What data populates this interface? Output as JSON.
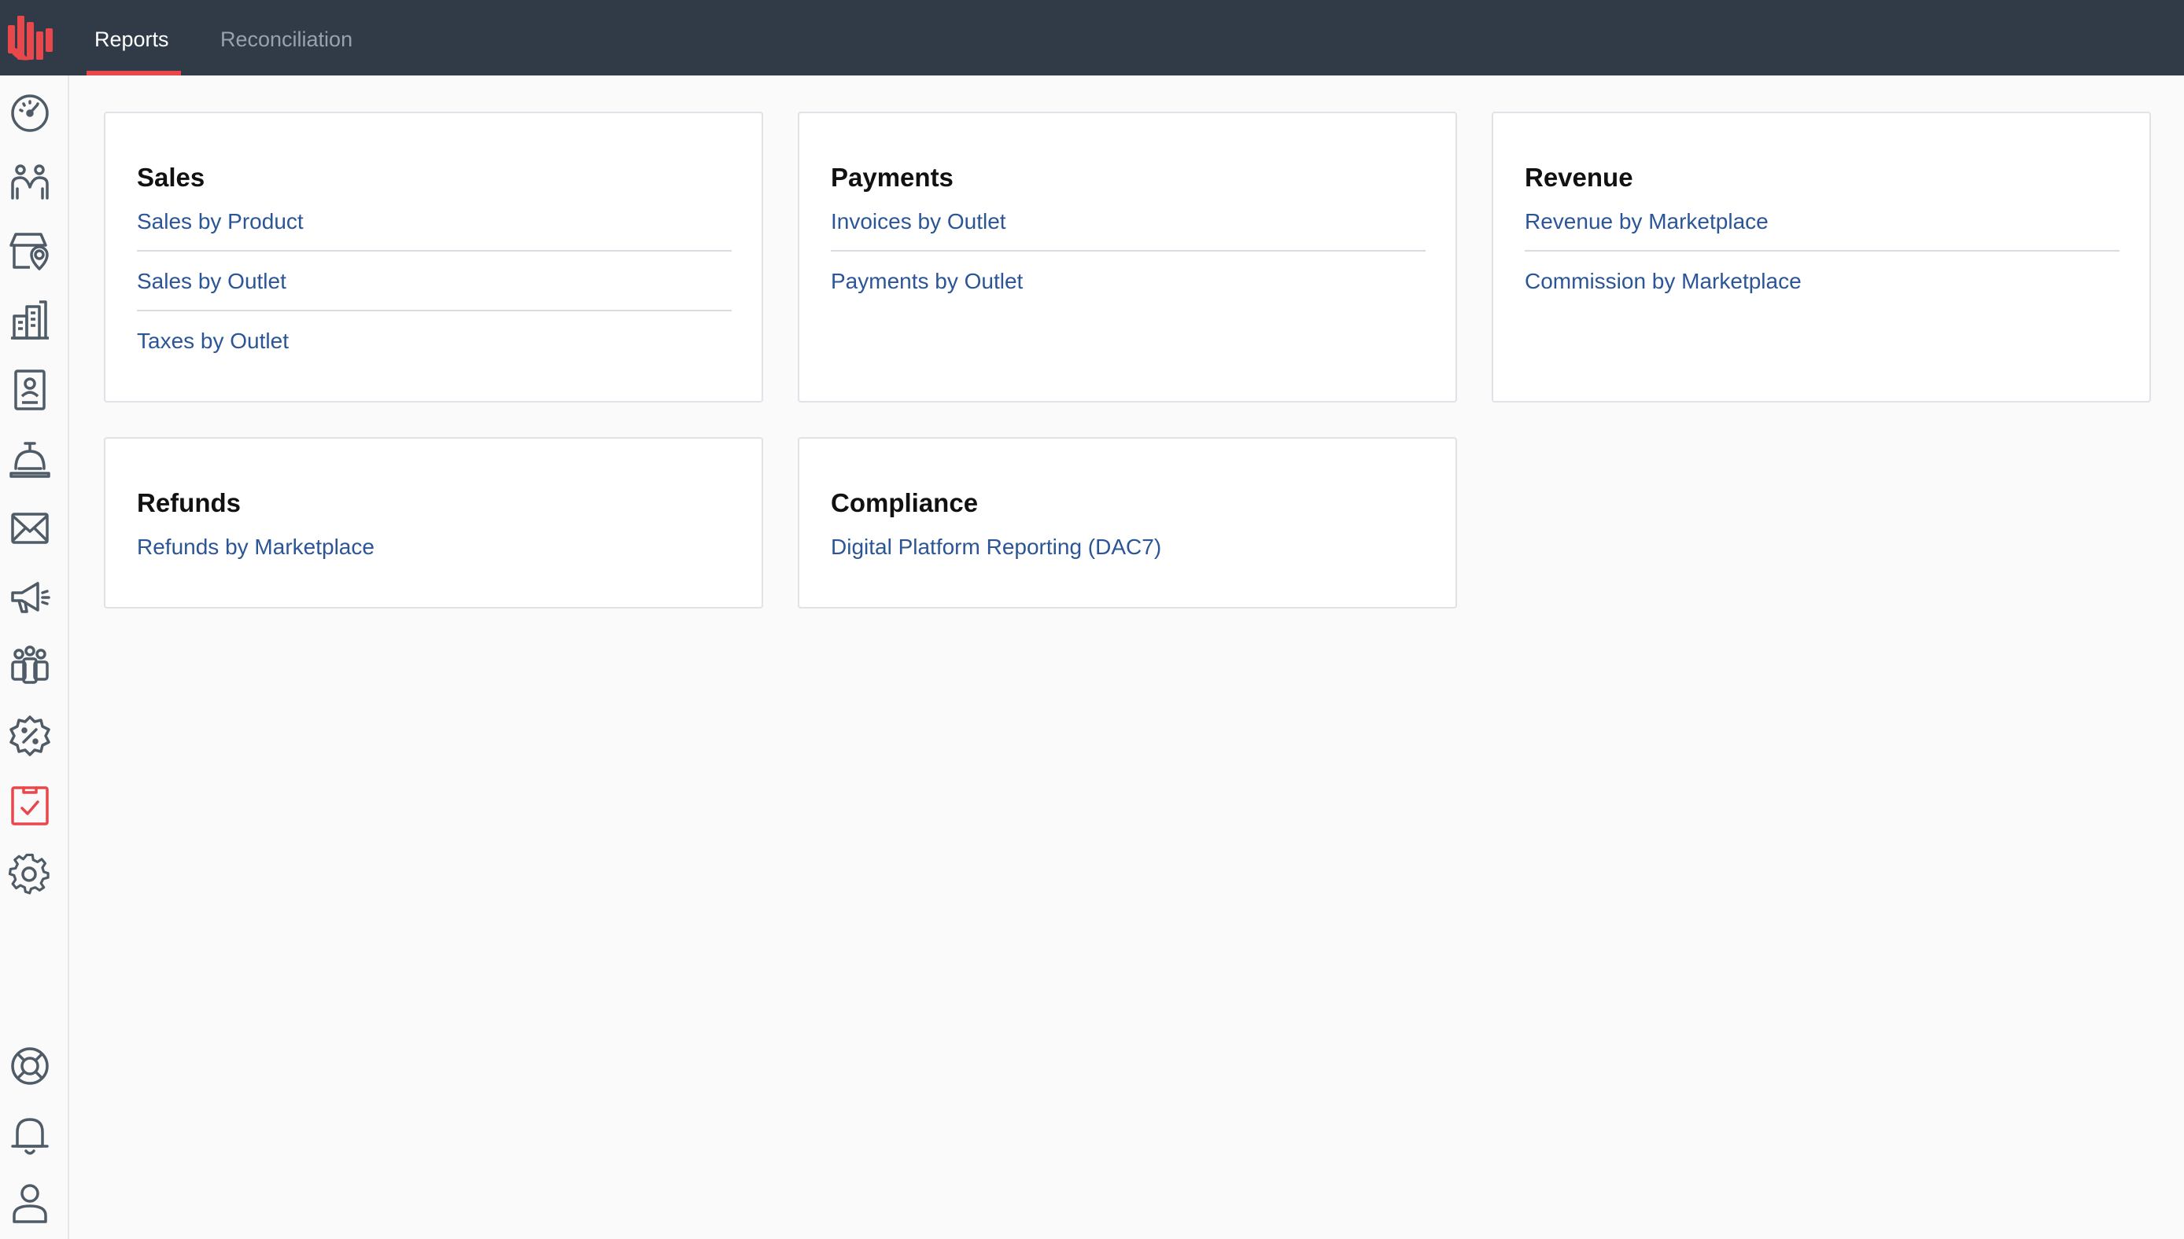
{
  "app": {
    "brand_color": "#e8474c",
    "header_bg": "#313b47",
    "link_color": "#2b5596"
  },
  "header": {
    "tabs": [
      {
        "label": "Reports",
        "active": true
      },
      {
        "label": "Reconciliation",
        "active": false
      }
    ]
  },
  "sidebar": {
    "items": [
      {
        "icon": "dashboard-gauge-icon",
        "active": false
      },
      {
        "icon": "customers-icon",
        "active": false
      },
      {
        "icon": "store-location-icon",
        "active": false
      },
      {
        "icon": "buildings-icon",
        "active": false
      },
      {
        "icon": "id-badge-icon",
        "active": false
      },
      {
        "icon": "service-bell-icon",
        "active": false
      },
      {
        "icon": "mail-icon",
        "active": false
      },
      {
        "icon": "megaphone-icon",
        "active": false
      },
      {
        "icon": "team-icon",
        "active": false
      },
      {
        "icon": "discount-badge-icon",
        "active": false
      },
      {
        "icon": "reports-clipboard-icon",
        "active": true
      },
      {
        "icon": "settings-gear-icon",
        "active": false
      }
    ],
    "bottom_items": [
      {
        "icon": "help-lifebuoy-icon"
      },
      {
        "icon": "notifications-bell-icon"
      },
      {
        "icon": "user-profile-icon"
      }
    ]
  },
  "cards": {
    "sales": {
      "title": "Sales",
      "links": [
        "Sales by Product",
        "Sales by Outlet",
        "Taxes by Outlet"
      ]
    },
    "payments": {
      "title": "Payments",
      "links": [
        "Invoices by Outlet",
        "Payments by Outlet"
      ]
    },
    "revenue": {
      "title": "Revenue",
      "links": [
        "Revenue by Marketplace",
        "Commission by Marketplace"
      ]
    },
    "refunds": {
      "title": "Refunds",
      "links": [
        "Refunds by Marketplace"
      ]
    },
    "compliance": {
      "title": "Compliance",
      "links": [
        "Digital Platform Reporting (DAC7)"
      ]
    }
  }
}
